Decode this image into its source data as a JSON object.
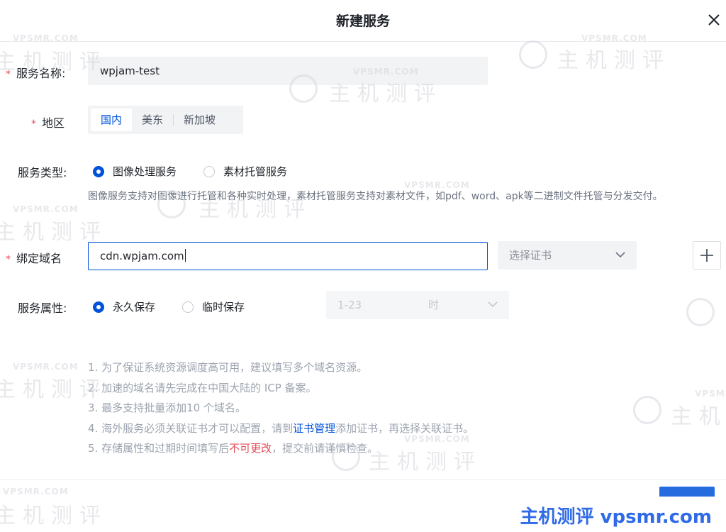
{
  "dialog": {
    "title": "新建服务",
    "close_icon": "close-icon"
  },
  "form": {
    "service_name": {
      "label": "服务名称:",
      "required": "*",
      "value": "wpjam-test"
    },
    "region": {
      "label": "地区",
      "required": "*",
      "options": [
        "国内",
        "美东",
        "新加坡"
      ],
      "selected": "国内"
    },
    "service_type": {
      "label": "服务类型:",
      "options": [
        "图像处理服务",
        "素材托管服务"
      ],
      "selected": "图像处理服务",
      "hint": "图像服务支持对图像进行托管和各种实时处理，素材托管服务支持对素材文件，如pdf、word、apk等二进制文件托管与分发交付。"
    },
    "domain": {
      "label": "绑定域名",
      "required": "*",
      "value": "cdn.wpjam.com",
      "cert_placeholder": "选择证书",
      "add_icon": "plus-icon"
    },
    "storage": {
      "label": "服务属性:",
      "options": [
        "永久保存",
        "临时保存"
      ],
      "selected": "永久保存",
      "hours_placeholder": "1-23",
      "hours_unit": "时"
    }
  },
  "notes": {
    "line1": "1. 为了保证系统资源调度高可用，建议填写多个域名资源。",
    "line2": "2. 加速的域名请先完成在中国大陆的 ICP 备案。",
    "line3": "3. 最多支持批量添加10 个域名。",
    "line4_before": "4. 海外服务必须关联证书才可以配置，请到",
    "line4_link": "证书管理",
    "line4_after": "添加证书，再选择关联证书。",
    "line5_before": "5. 存储属性和过期时间填写后",
    "line5_danger": "不可更改",
    "line5_after": "，提交前请谨慎检查。"
  },
  "watermark": {
    "site": "VPSMR.COM",
    "brand": "主机测评",
    "badge": "主机测评 vpsmr.com"
  },
  "colors": {
    "primary": "#0052d9",
    "danger": "#e34d59",
    "input_bg": "#f2f3f5"
  }
}
